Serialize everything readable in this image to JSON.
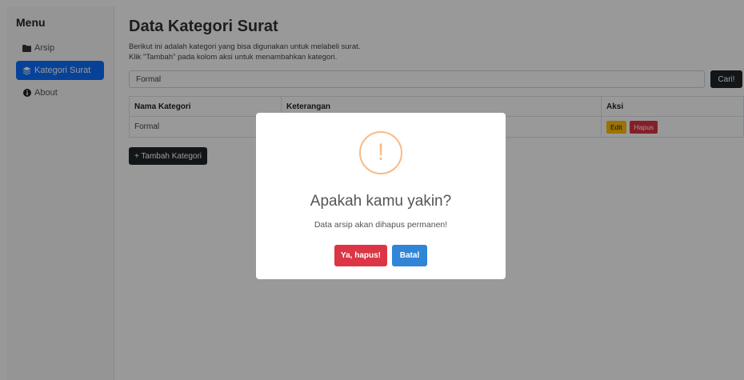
{
  "sidebar": {
    "title": "Menu",
    "items": [
      {
        "label": "Arsip",
        "icon": "folder-icon"
      },
      {
        "label": "Kategori Surat",
        "icon": "layers-icon",
        "active": true
      },
      {
        "label": "About",
        "icon": "info-icon"
      }
    ]
  },
  "main": {
    "title": "Data Kategori Surat",
    "description_line1": "Berikut ini adalah kategori yang bisa digunakan untuk melabeli surat.",
    "description_line2": "Klik \"Tambah\" pada kolom aksi untuk menambahkan kategori.",
    "search": {
      "value": "Formal",
      "button_label": "Cari!"
    },
    "table": {
      "headers": [
        "Nama Kategori",
        "Keterangan",
        "Aksi"
      ],
      "rows": [
        {
          "name": "Formal",
          "description": "",
          "edit_label": "Edit",
          "delete_label": "Hapus"
        }
      ]
    },
    "add_button_label": "+ Tambah Kategori"
  },
  "modal": {
    "icon_glyph": "!",
    "title": "Apakah kamu yakin?",
    "text": "Data arsip akan dihapus permanen!",
    "confirm_label": "Ya, hapus!",
    "cancel_label": "Batal"
  },
  "colors": {
    "primary": "#0d6efd",
    "dark": "#212529",
    "warning": "#ffc107",
    "danger": "#dc3545",
    "cancel": "#3085d6",
    "warning_icon": "#f8bb86"
  }
}
